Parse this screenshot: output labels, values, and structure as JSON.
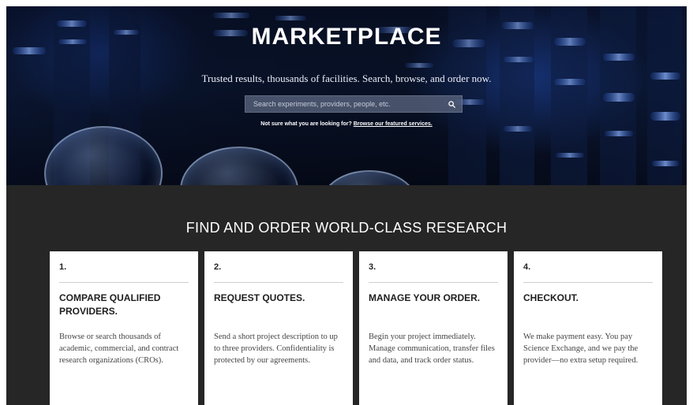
{
  "hero": {
    "title": "MARKETPLACE",
    "subtitle": "Trusted results, thousands of facilities. Search, browse, and order now.",
    "search": {
      "placeholder": "Search experiments, providers, people, etc.",
      "icon": "search-icon"
    },
    "hint_prefix": "Not sure what you are looking for?",
    "hint_link": "Browse our featured services."
  },
  "section": {
    "title": "FIND AND ORDER WORLD-CLASS RESEARCH",
    "steps": [
      {
        "number": "1.",
        "title": "COMPARE QUALIFIED PROVIDERS.",
        "description": "Browse or search thousands of academic, commercial, and contract research organizations (CROs)."
      },
      {
        "number": "2.",
        "title": "REQUEST QUOTES.",
        "description": "Send a short project description to up to three providers. Confidentiality is protected by our agreements."
      },
      {
        "number": "3.",
        "title": "MANAGE YOUR ORDER.",
        "description": "Begin your project immediately. Manage communication, transfer files and data, and track order status."
      },
      {
        "number": "4.",
        "title": "CHECKOUT.",
        "description": "We make payment easy. You pay Science Exchange, and we pay the provider—no extra setup required."
      }
    ]
  },
  "colors": {
    "hero_bg": "#0a1430",
    "accent_blue": "#3f7be6",
    "section_bg": "#262626",
    "card_bg": "#ffffff"
  }
}
